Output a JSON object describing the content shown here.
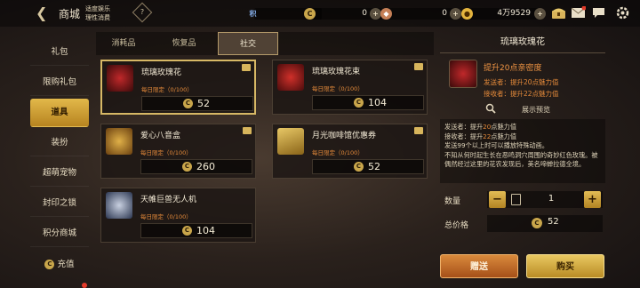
{
  "header": {
    "title": "商城",
    "tip_line1": "适度娱乐",
    "tip_line2": "理性消费",
    "help_glyph": "?"
  },
  "resources": [
    {
      "icon": "points-icon",
      "glyph": "积",
      "value": "0"
    },
    {
      "icon": "coupon-coin-icon",
      "glyph": "C",
      "value": "0"
    },
    {
      "icon": "diamond-icon",
      "glyph": "◆",
      "value": "0"
    },
    {
      "icon": "gold-coin-icon",
      "glyph": "●",
      "value": "4万9529"
    }
  ],
  "sidebar": {
    "items": [
      {
        "label": "礼包"
      },
      {
        "label": "限购礼包"
      },
      {
        "label": "道具",
        "active": true
      },
      {
        "label": "装扮"
      },
      {
        "label": "超萌宠物"
      },
      {
        "label": "封印之锁"
      },
      {
        "label": "积分商城"
      }
    ],
    "recharge_label": "充值"
  },
  "tabs": [
    {
      "label": "消耗品"
    },
    {
      "label": "恢复品"
    },
    {
      "label": "社交",
      "active": true
    }
  ],
  "items": [
    {
      "name": "琉璃玫瑰花",
      "limit": "每日限定（0/100）",
      "price": "52",
      "thumb_color": "#7a1414",
      "selected": true
    },
    {
      "name": "琉璃玫瑰花束",
      "limit": "每日限定（0/100）",
      "price": "104",
      "thumb_color": "#8a1a1a"
    },
    {
      "name": "爱心八音盒",
      "limit": "每日限定（0/100）",
      "price": "260",
      "thumb_color": "#9a6a20"
    },
    {
      "name": "月光咖啡馆优惠券",
      "limit": "每日限定（0/100）",
      "price": "52",
      "thumb_color": "#9c7a2c"
    },
    {
      "name": "天帷巨兽无人机",
      "limit": "每日限定（0/100）",
      "price": "104",
      "thumb_color": "#3a4c6a"
    }
  ],
  "detail": {
    "title": "琉璃玫瑰花",
    "effect": "提升20点亲密度",
    "sender_label": "发送者：",
    "sender_text": "提升20点魅力值",
    "receiver_label": "接收者：",
    "receiver_text": "提升22点魅力值",
    "preview_label": "展示预览",
    "desc_l1a": "发送者：提升",
    "desc_l1b": "20",
    "desc_l1c": "点魅力值",
    "desc_l2a": "接收者：提升",
    "desc_l2b": "22",
    "desc_l2c": "点魅力值",
    "desc_l3": "发送99个以上时可以播放特殊动画。",
    "desc_l4": "不知从何时起生长在恶鸣洞穴周围的奇妙红色玫瑰。被偶然经过这里的花农发现后，美名啼蝉拉德全境。",
    "qty_label": "数量",
    "qty_value": "1",
    "total_label": "总价格",
    "total_value": "52",
    "gift_button": "赠送",
    "buy_button": "购买"
  }
}
